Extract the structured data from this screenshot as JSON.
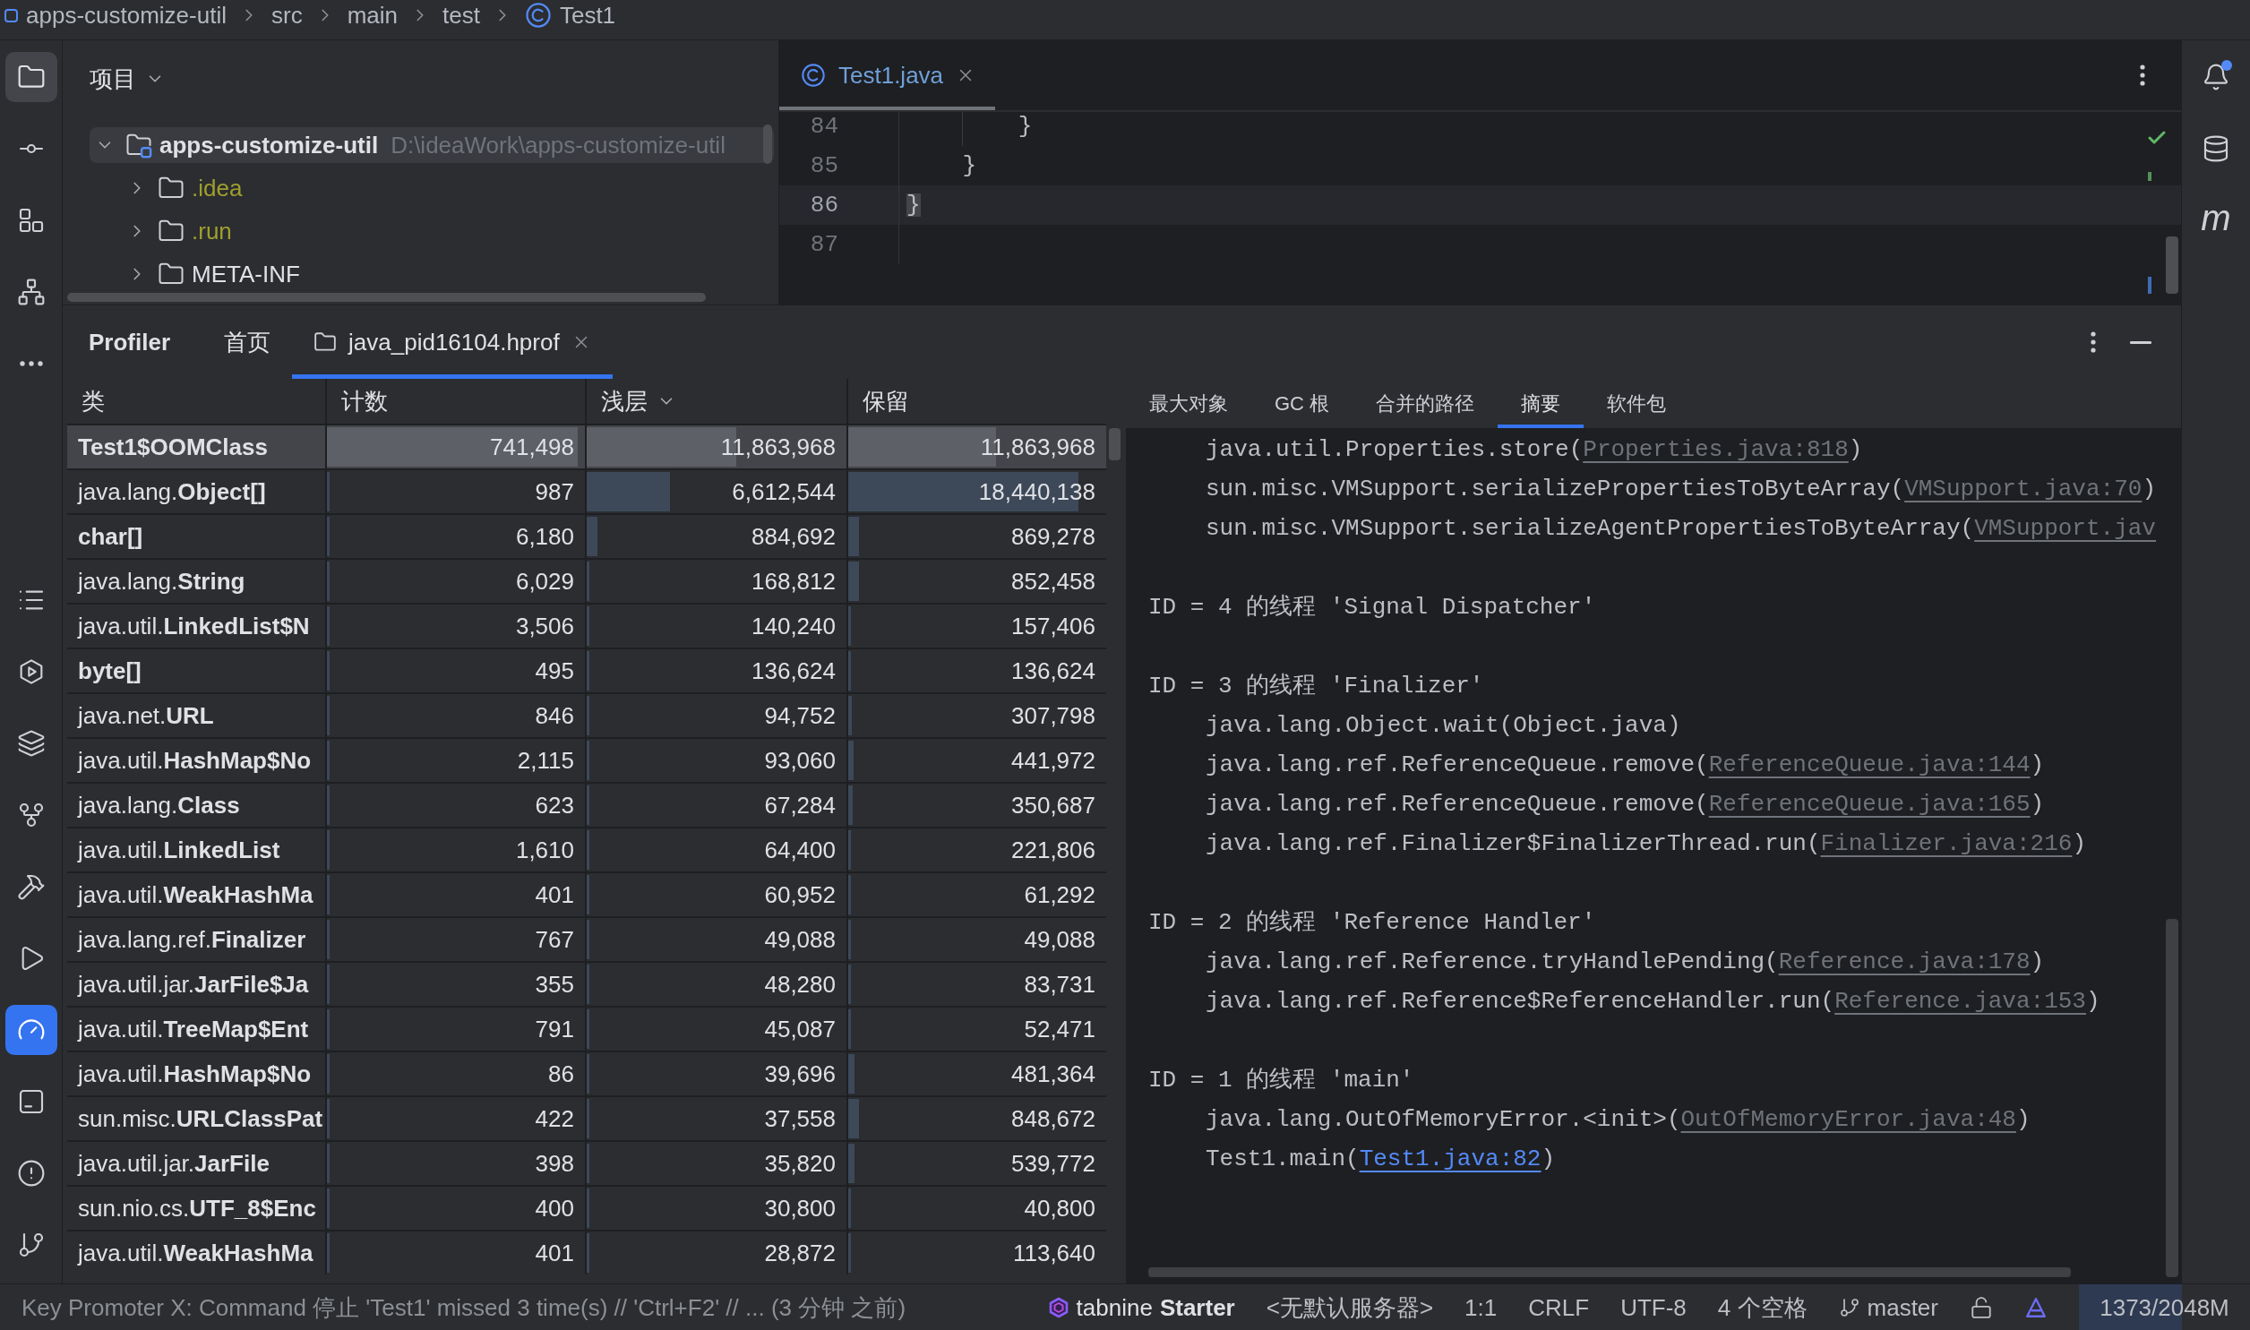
{
  "breadcrumbs": [
    {
      "label": "apps-customize-util",
      "kind": "module"
    },
    {
      "label": "src",
      "kind": "folder"
    },
    {
      "label": "main",
      "kind": "folder"
    },
    {
      "label": "test",
      "kind": "folder"
    },
    {
      "label": "Test1",
      "kind": "class"
    }
  ],
  "left_toolbar": {
    "top": [
      {
        "selected": true,
        "focused": false
      },
      {
        "selected": false,
        "focused": false
      },
      {
        "selected": false,
        "focused": false
      },
      {
        "selected": false,
        "focused": false
      },
      {
        "selected": false,
        "focused": false
      }
    ],
    "bottom": [
      {
        "selected": false,
        "focused": false
      },
      {
        "selected": false,
        "focused": false
      },
      {
        "selected": false,
        "focused": false
      },
      {
        "selected": false,
        "focused": false
      },
      {
        "selected": false,
        "focused": false
      },
      {
        "selected": false,
        "focused": false
      },
      {
        "selected": true,
        "focused": true
      },
      {
        "selected": false,
        "focused": false
      },
      {
        "selected": false,
        "focused": false
      },
      {
        "selected": false,
        "focused": false
      }
    ]
  },
  "right_toolbar": {
    "notifications_unread": true,
    "maven_glyph": "m"
  },
  "project_panel": {
    "title": "项目",
    "tree": [
      {
        "label": "apps-customize-util",
        "kind": "module",
        "path": "D:\\ideaWork\\apps-customize-util",
        "expanded": true,
        "selected": true,
        "children": [
          {
            "label": ".idea",
            "kind": "folder",
            "expanded": false,
            "selected": false,
            "ignored": true
          },
          {
            "label": ".run",
            "kind": "folder",
            "expanded": false,
            "selected": false,
            "ignored": true
          },
          {
            "label": "META-INF",
            "kind": "folder",
            "expanded": false,
            "selected": false,
            "ignored": false
          }
        ]
      }
    ]
  },
  "editor": {
    "tabs": [
      {
        "label": "Test1.java",
        "selected": true,
        "modified": true
      }
    ],
    "lines": [
      {
        "number": "84",
        "code": "        }",
        "current": false
      },
      {
        "number": "85",
        "code": "    }",
        "current": false
      },
      {
        "number": "86",
        "code": "}",
        "current": true
      },
      {
        "number": "87",
        "current": false
      }
    ]
  },
  "profiler": {
    "title": "Profiler",
    "tabs": [
      {
        "label": "首页",
        "kind": "home",
        "selected": false
      },
      {
        "label": "java_pid16104.hprof",
        "kind": "file",
        "selected": true,
        "closable": true
      }
    ],
    "table": {
      "columns": [
        {
          "label": "类",
          "sorted": false
        },
        {
          "label": "计数",
          "sorted": false
        },
        {
          "label": "浅层",
          "sorted": true
        },
        {
          "label": "保留",
          "sorted": false
        }
      ],
      "rows": [
        {
          "name": "Test1$OOMClass",
          "selected": true,
          "count": {
            "value": "741,498",
            "level": 0.971
          },
          "shallow": {
            "value": "11,863,968",
            "level": 0.576
          },
          "retained": {
            "value": "11,863,968",
            "level": 0.573
          }
        },
        {
          "package": "java.lang.",
          "name": "Object[]",
          "selected": false,
          "count": {
            "value": "987",
            "level": 0.001
          },
          "shallow": {
            "value": "6,612,544",
            "level": 0.321
          },
          "retained": {
            "value": "18,440,138",
            "level": 0.891
          }
        },
        {
          "name": "char[]",
          "selected": false,
          "count": {
            "value": "6,180",
            "level": 0.008
          },
          "shallow": {
            "value": "884,692",
            "level": 0.043
          },
          "retained": {
            "value": "869,278",
            "level": 0.042
          }
        },
        {
          "package": "java.lang.",
          "name": "String",
          "selected": false,
          "count": {
            "value": "6,029",
            "level": 0.008
          },
          "shallow": {
            "value": "168,812",
            "level": 0.008
          },
          "retained": {
            "value": "852,458",
            "level": 0.041
          }
        },
        {
          "package": "java.util.",
          "name": "LinkedList$N",
          "selected": false,
          "count": {
            "value": "3,506",
            "level": 0.005
          },
          "shallow": {
            "value": "140,240",
            "level": 0.007
          },
          "retained": {
            "value": "157,406",
            "level": 0.008
          }
        },
        {
          "name": "byte[]",
          "selected": false,
          "count": {
            "value": "495",
            "level": 0.001
          },
          "shallow": {
            "value": "136,624",
            "level": 0.007
          },
          "retained": {
            "value": "136,624",
            "level": 0.007
          }
        },
        {
          "package": "java.net.",
          "name": "URL",
          "selected": false,
          "count": {
            "value": "846",
            "level": 0.001
          },
          "shallow": {
            "value": "94,752",
            "level": 0.005
          },
          "retained": {
            "value": "307,798",
            "level": 0.015
          }
        },
        {
          "package": "java.util.",
          "name": "HashMap$No",
          "selected": false,
          "count": {
            "value": "2,115",
            "level": 0.003
          },
          "shallow": {
            "value": "93,060",
            "level": 0.005
          },
          "retained": {
            "value": "441,972",
            "level": 0.021
          }
        },
        {
          "package": "java.lang.",
          "name": "Class",
          "selected": false,
          "count": {
            "value": "623",
            "level": 0.001
          },
          "shallow": {
            "value": "67,284",
            "level": 0.003
          },
          "retained": {
            "value": "350,687",
            "level": 0.017
          }
        },
        {
          "package": "java.util.",
          "name": "LinkedList",
          "selected": false,
          "count": {
            "value": "1,610",
            "level": 0.002
          },
          "shallow": {
            "value": "64,400",
            "level": 0.003
          },
          "retained": {
            "value": "221,806",
            "level": 0.011
          }
        },
        {
          "package": "java.util.",
          "name": "WeakHashMa",
          "selected": false,
          "count": {
            "value": "401",
            "level": 0.001
          },
          "shallow": {
            "value": "60,952",
            "level": 0.003
          },
          "retained": {
            "value": "61,292",
            "level": 0.003
          }
        },
        {
          "package": "java.lang.ref.",
          "name": "Finalizer",
          "selected": false,
          "count": {
            "value": "767",
            "level": 0.001
          },
          "shallow": {
            "value": "49,088",
            "level": 0.002
          },
          "retained": {
            "value": "49,088",
            "level": 0.002
          }
        },
        {
          "package": "java.util.jar.",
          "name": "JarFile$Ja",
          "selected": false,
          "count": {
            "value": "355",
            "level": 0.001
          },
          "shallow": {
            "value": "48,280",
            "level": 0.002
          },
          "retained": {
            "value": "83,731",
            "level": 0.004
          }
        },
        {
          "package": "java.util.",
          "name": "TreeMap$Ent",
          "selected": false,
          "count": {
            "value": "791",
            "level": 0.001
          },
          "shallow": {
            "value": "45,087",
            "level": 0.002
          },
          "retained": {
            "value": "52,471",
            "level": 0.003
          }
        },
        {
          "package": "java.util.",
          "name": "HashMap$No",
          "selected": false,
          "count": {
            "value": "86",
            "level": 0.001
          },
          "shallow": {
            "value": "39,696",
            "level": 0.002
          },
          "retained": {
            "value": "481,364",
            "level": 0.023
          }
        },
        {
          "package": "sun.misc.",
          "name": "URLClassPat",
          "selected": false,
          "count": {
            "value": "422",
            "level": 0.001
          },
          "shallow": {
            "value": "37,558",
            "level": 0.002
          },
          "retained": {
            "value": "848,672",
            "level": 0.041
          }
        },
        {
          "package": "java.util.jar.",
          "name": "JarFile",
          "selected": false,
          "count": {
            "value": "398",
            "level": 0.001
          },
          "shallow": {
            "value": "35,820",
            "level": 0.002
          },
          "retained": {
            "value": "539,772",
            "level": 0.026
          }
        },
        {
          "package": "sun.nio.cs.",
          "name": "UTF_8$Enc",
          "selected": false,
          "count": {
            "value": "400",
            "level": 0.001
          },
          "shallow": {
            "value": "30,800",
            "level": 0.001
          },
          "retained": {
            "value": "40,800",
            "level": 0.002
          }
        },
        {
          "package": "java.util.",
          "name": "WeakHashMa",
          "selected": false,
          "count": {
            "value": "401",
            "level": 0.001
          },
          "shallow": {
            "value": "28,872",
            "level": 0.001
          },
          "retained": {
            "value": "113,640",
            "level": 0.005
          }
        }
      ]
    },
    "detail": {
      "tabs": [
        {
          "label": "最大对象",
          "selected": false
        },
        {
          "label": "GC 根",
          "selected": false
        },
        {
          "label": "合并的路径",
          "selected": false
        },
        {
          "label": "摘要",
          "selected": true
        },
        {
          "label": "软件包",
          "selected": false
        }
      ],
      "threads": [
        {
          "frames": [
            {
              "call": "java.util.Properties.store(",
              "link": {
                "text": "Properties.java:818",
                "kind": "library"
              },
              "close": ")"
            },
            {
              "call": "sun.misc.VMSupport.serializePropertiesToByteArray(",
              "link": {
                "text": "VMSupport.java:70",
                "kind": "library"
              },
              "close": ")"
            },
            {
              "call": "sun.misc.VMSupport.serializeAgentPropertiesToByteArray(",
              "link": {
                "text": "VMSupport.jav",
                "kind": "library"
              }
            }
          ]
        },
        {
          "header": "ID = 4 的线程 'Signal Dispatcher'"
        },
        {
          "header": "ID = 3 的线程 'Finalizer'",
          "frames": [
            {
              "call": "java.lang.Object.wait(Object.java)"
            },
            {
              "call": "java.lang.ref.ReferenceQueue.remove(",
              "link": {
                "text": "ReferenceQueue.java:144",
                "kind": "library"
              },
              "close": ")"
            },
            {
              "call": "java.lang.ref.ReferenceQueue.remove(",
              "link": {
                "text": "ReferenceQueue.java:165",
                "kind": "library"
              },
              "close": ")"
            },
            {
              "call": "java.lang.ref.Finalizer$FinalizerThread.run(",
              "link": {
                "text": "Finalizer.java:216",
                "kind": "library"
              },
              "close": ")"
            }
          ]
        },
        {
          "header": "ID = 2 的线程 'Reference Handler'",
          "frames": [
            {
              "call": "java.lang.ref.Reference.tryHandlePending(",
              "link": {
                "text": "Reference.java:178",
                "kind": "library"
              },
              "close": ")"
            },
            {
              "call": "java.lang.ref.Reference$ReferenceHandler.run(",
              "link": {
                "text": "Reference.java:153",
                "kind": "library"
              },
              "close": ")"
            }
          ]
        },
        {
          "header": "ID = 1 的线程 'main'",
          "frames": [
            {
              "call": "java.lang.OutOfMemoryError.<init>(",
              "link": {
                "text": "OutOfMemoryError.java:48",
                "kind": "library"
              },
              "close": ")"
            },
            {
              "call": "Test1.main(",
              "link": {
                "text": "Test1.java:82",
                "kind": "project"
              },
              "close": ")"
            }
          ]
        }
      ]
    }
  },
  "status_bar": {
    "message": "Key Promoter X: Command 停止 'Test1' missed 3 time(s) // 'Ctrl+F2' // ... (3 分钟 之前)",
    "plugin": {
      "name": "tabnine",
      "plan": "Starter"
    },
    "server": "<无默认服务器>",
    "position": "1:1",
    "line_separator": "CRLF",
    "encoding": "UTF-8",
    "indent": "4 个空格",
    "branch": "master",
    "file_writable": true,
    "memory": {
      "text": "1373/2048M",
      "level": 0.6
    }
  }
}
